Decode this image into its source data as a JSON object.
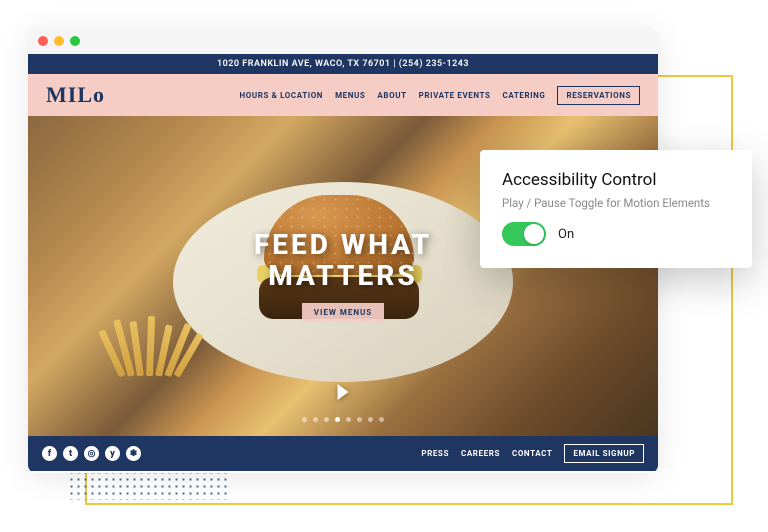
{
  "topbar": {
    "text": "1020 FRANKLIN AVE, WACO, TX 76701  |  (254) 235-1243"
  },
  "logo": "MILo",
  "nav": {
    "hours": "HOURS & LOCATION",
    "menus": "MENUS",
    "about": "ABOUT",
    "private": "PRIVATE EVENTS",
    "catering": "CATERING",
    "reservations": "RESERVATIONS"
  },
  "hero": {
    "line1": "FEED WHAT",
    "line2": "MATTERS",
    "cta": "VIEW MENUS"
  },
  "footer": {
    "socials": {
      "fb": "f",
      "tw": "t",
      "ig": "◎",
      "yelp": "y",
      "ta": "✽"
    },
    "press": "PRESS",
    "careers": "CAREERS",
    "contact": "CONTACT",
    "email": "EMAIL SIGNUP"
  },
  "popup": {
    "title": "Accessibility Control",
    "desc": "Play / Pause Toggle for Motion Elements",
    "state": "On"
  }
}
